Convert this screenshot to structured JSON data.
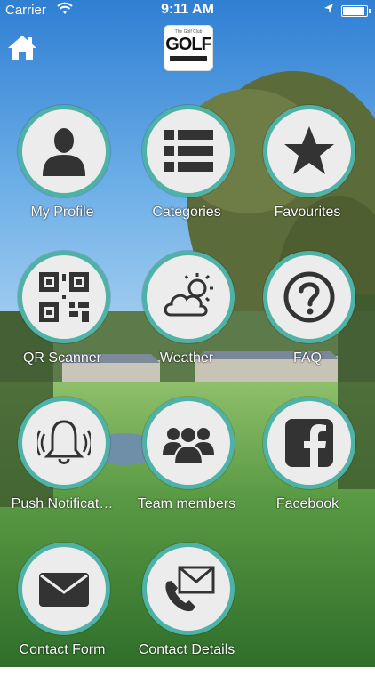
{
  "status_bar": {
    "carrier": "Carrier",
    "time": "9:11 AM"
  },
  "logo": {
    "tagline": "The Golf Club",
    "text": "GOLF"
  },
  "tiles": [
    {
      "label": "My Profile",
      "icon": "person-icon"
    },
    {
      "label": "Categories",
      "icon": "list-icon"
    },
    {
      "label": "Favourites",
      "icon": "star-icon"
    },
    {
      "label": "QR Scanner",
      "icon": "qr-code-icon"
    },
    {
      "label": "Weather",
      "icon": "weather-icon"
    },
    {
      "label": "FAQ",
      "icon": "question-icon"
    },
    {
      "label": "Push Notificat…",
      "icon": "bell-icon"
    },
    {
      "label": "Team members",
      "icon": "team-icon"
    },
    {
      "label": "Facebook",
      "icon": "facebook-icon"
    },
    {
      "label": "Contact Form",
      "icon": "envelope-icon"
    },
    {
      "label": "Contact Details",
      "icon": "phone-envelope-icon"
    }
  ],
  "colors": {
    "ring": "#4fb2a6",
    "icon": "#333333",
    "sky": "#4a93d8",
    "grass": "#3f8a3a"
  }
}
